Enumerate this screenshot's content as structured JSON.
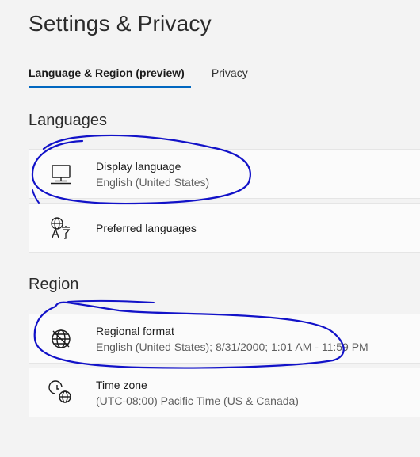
{
  "page": {
    "title": "Settings & Privacy"
  },
  "tabs": [
    {
      "label": "Language & Region (preview)",
      "active": true
    },
    {
      "label": "Privacy",
      "active": false
    }
  ],
  "languages": {
    "heading": "Languages",
    "items": [
      {
        "title": "Display language",
        "subtitle": "English (United States)",
        "icon": "monitor-icon"
      },
      {
        "title": "Preferred languages",
        "subtitle": "",
        "icon": "language-translate-icon"
      }
    ]
  },
  "region": {
    "heading": "Region",
    "items": [
      {
        "title": "Regional format",
        "subtitle": "English (United States); 8/31/2000; 1:01 AM - 11:59 PM",
        "icon": "globe-format-icon"
      },
      {
        "title": "Time zone",
        "subtitle": "(UTC-08:00) Pacific Time (US & Canada)",
        "icon": "clock-globe-icon"
      }
    ]
  },
  "colors": {
    "accent": "#0067c0",
    "annotation_ink": "#1212c8",
    "background": "#f3f3f3",
    "card": "#fbfbfb"
  }
}
